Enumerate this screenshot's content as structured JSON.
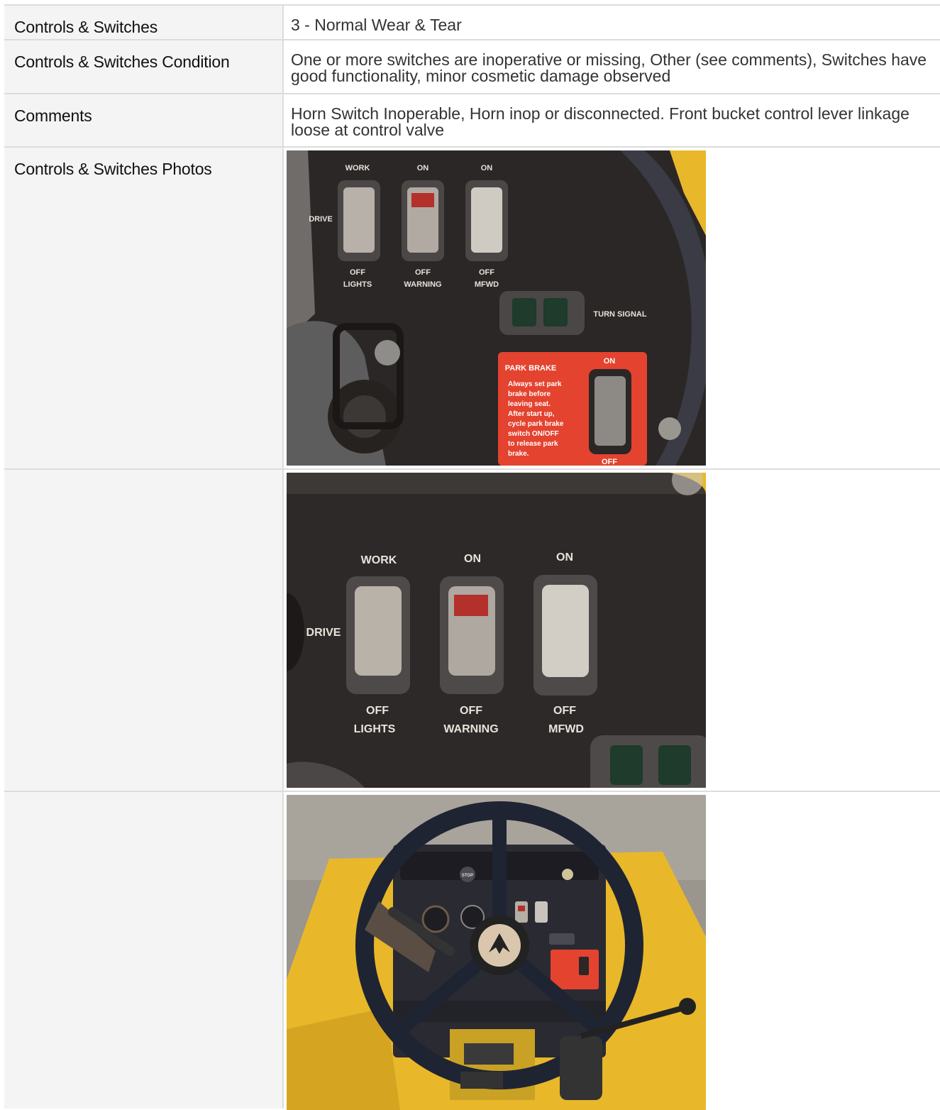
{
  "rows": [
    {
      "label": "Controls & Switches",
      "value": "3 - Normal Wear & Tear"
    },
    {
      "label": "Controls & Switches Condition",
      "value": "One or more switches are inoperative or missing, Other (see comments), Switches have good functionality, minor cosmetic damage observed"
    },
    {
      "label": "Comments",
      "value": "Horn Switch Inoperable, Horn inop or disconnected. Front bucket control lever linkage loose at control valve"
    },
    {
      "label": "Controls & Switches Photos",
      "value": ""
    }
  ],
  "photo1": {
    "work": "WORK",
    "on1": "ON",
    "on2": "ON",
    "drive": "DRIVE",
    "off1": "OFF",
    "off2": "OFF",
    "off3": "OFF",
    "lights": "LIGHTS",
    "warning": "WARNING",
    "mfwd": "MFWD",
    "turn_signal": "TURN SIGNAL",
    "park_brake": "PARK BRAKE",
    "pb_text": [
      "Always set park",
      "brake before",
      "leaving seat.",
      "After start up,",
      "cycle park brake",
      "switch ON/OFF",
      "to release park",
      "brake."
    ],
    "pb_on": "ON",
    "pb_off": "OFF"
  },
  "photo2": {
    "work": "WORK",
    "on1": "ON",
    "on2": "ON",
    "drive": "DRIVE",
    "off1": "OFF",
    "off2": "OFF",
    "off3": "OFF",
    "lights": "LIGHTS",
    "warning": "WARNING",
    "mfwd": "MFWD"
  },
  "photo3": {
    "stop": "STOP"
  },
  "colors": {
    "panel": "#2b2726",
    "switch": "#b7b1aa",
    "red_lamp": "#b3302b",
    "green_lamp": "#1e3b2c",
    "park_label": "#e4432f",
    "machine_yellow": "#e8b82a",
    "label_bg": "#f4f4f4",
    "border": "#dcdcdc"
  }
}
